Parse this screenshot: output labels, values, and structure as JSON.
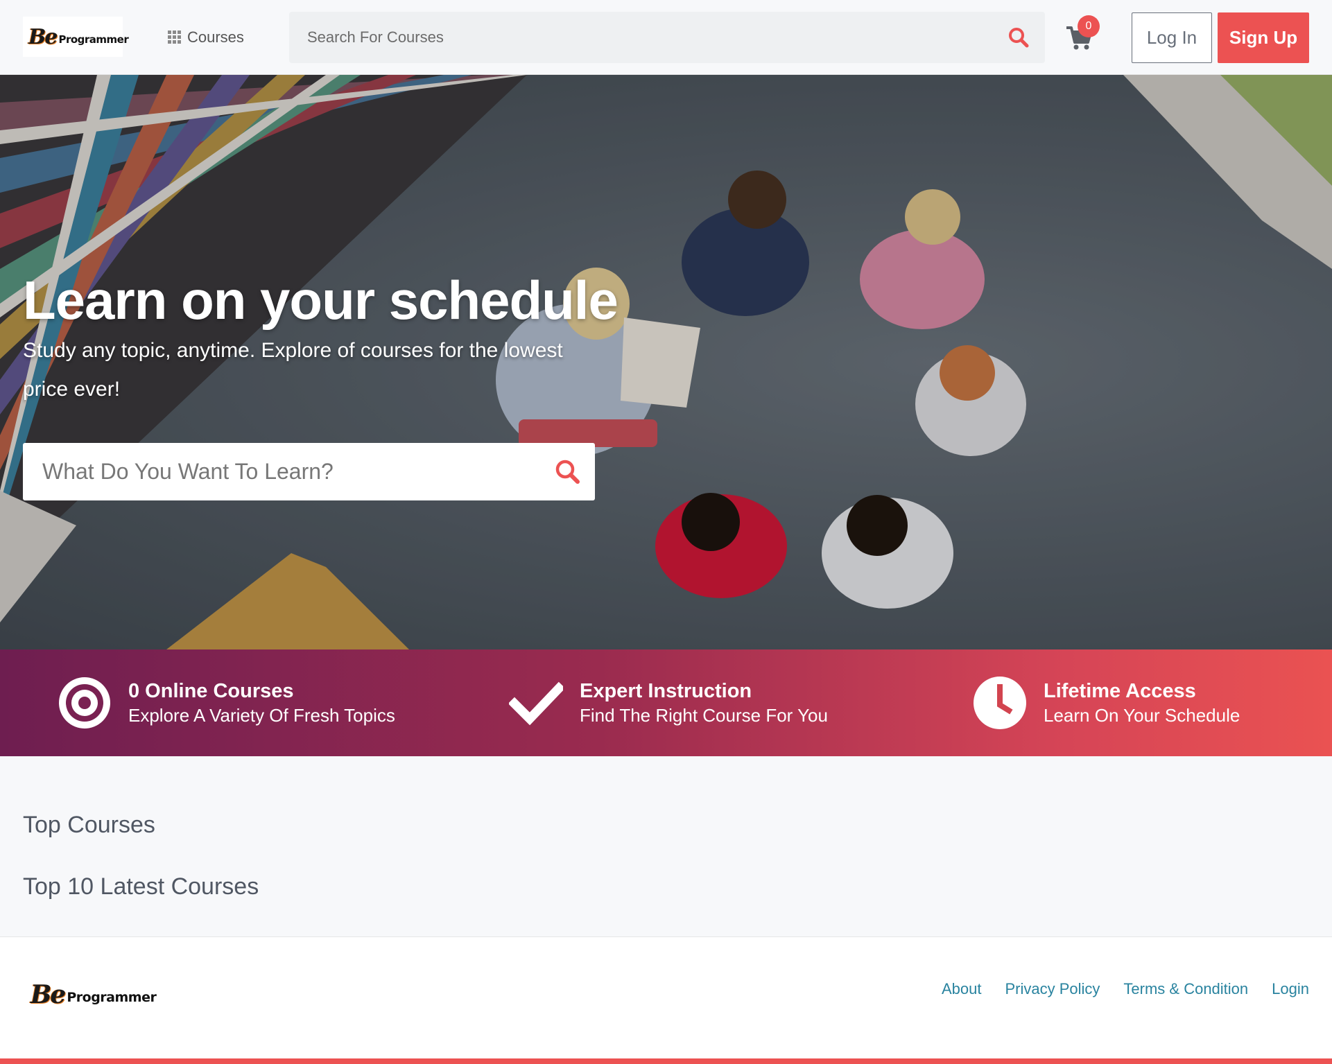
{
  "brand": {
    "logo_mark": "Be",
    "logo_text": "Programmer"
  },
  "header": {
    "courses_label": "Courses",
    "search_placeholder": "Search For Courses",
    "cart_count": "0",
    "login_label": "Log In",
    "signup_label": "Sign Up"
  },
  "hero": {
    "title": "Learn on your schedule",
    "subtitle": "Study any topic, anytime. Explore of courses for the lowest price ever!",
    "search_placeholder": "What Do You Want To Learn?"
  },
  "features": [
    {
      "icon": "target-icon",
      "title": "0 Online Courses",
      "desc": "Explore A Variety Of Fresh Topics"
    },
    {
      "icon": "checkmark-icon",
      "title": "Expert Instruction",
      "desc": "Find The Right Course For You"
    },
    {
      "icon": "clock-icon",
      "title": "Lifetime Access",
      "desc": "Learn On Your Schedule"
    }
  ],
  "sections": {
    "top_courses": "Top Courses",
    "latest_courses": "Top 10 Latest Courses"
  },
  "footer": {
    "links": [
      "About",
      "Privacy Policy",
      "Terms & Condition",
      "Login"
    ]
  },
  "colors": {
    "accent": "#ec5252",
    "link": "#29839f",
    "band_start": "#6e1e50",
    "band_end": "#ea5252"
  }
}
